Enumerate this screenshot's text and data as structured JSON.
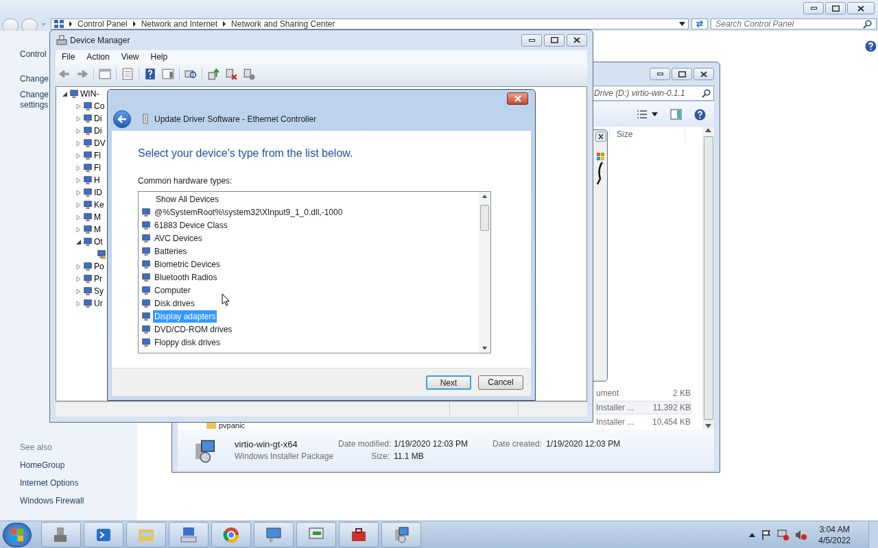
{
  "control_panel": {
    "breadcrumb": [
      "Control Panel",
      "Network and Internet",
      "Network and Sharing Center"
    ],
    "search": {
      "placeholder": "Search Control Panel"
    },
    "sidebar_links": [
      "Control",
      "Change",
      "Change settings"
    ],
    "see_also": {
      "title": "See also",
      "links": [
        "HomeGroup",
        "Internet Options",
        "Windows Firewall"
      ]
    }
  },
  "explorer": {
    "address": "Drive (D:) virtio-win-0.1.1",
    "columns": [
      "Size"
    ],
    "rows": [
      {
        "column_1": "ument",
        "size": "2 KB",
        "selected": false
      },
      {
        "column_1": "Installer ...",
        "size": "11,392 KB",
        "selected": true
      },
      {
        "nav_folder": "pvpanic",
        "column_1": "Installer ...",
        "size": "10,454 KB",
        "selected": false
      }
    ],
    "details": {
      "name": "virtio-win-gt-x64",
      "type": "Windows Installer Package",
      "fields": [
        {
          "label": "Date modified:",
          "value": "1/19/2020 12:03 PM"
        },
        {
          "label": "Size:",
          "value": "11.1 MB"
        },
        {
          "label": "Date created:",
          "value": "1/19/2020 12:03 PM"
        }
      ]
    }
  },
  "device_manager": {
    "title": "Device Manager",
    "menu": [
      "File",
      "Action",
      "View",
      "Help"
    ],
    "tree": {
      "label": "WIN-",
      "expanded": true,
      "children": [
        {
          "label": "Co",
          "expanded": false
        },
        {
          "label": "Di",
          "expanded": false
        },
        {
          "label": "Di",
          "expanded": false
        },
        {
          "label": "DV",
          "expanded": false
        },
        {
          "label": "Fl",
          "expanded": false
        },
        {
          "label": "Fl",
          "expanded": false
        },
        {
          "label": "H",
          "expanded": false
        },
        {
          "label": "ID",
          "expanded": false
        },
        {
          "label": "Ke",
          "expanded": false
        },
        {
          "label": "M",
          "expanded": false
        },
        {
          "label": "M",
          "expanded": false
        },
        {
          "label": "Ot",
          "expanded": true,
          "children": [
            {
              "kind": "warning"
            }
          ]
        },
        {
          "label": "Po",
          "expanded": false
        },
        {
          "label": "Pr",
          "expanded": false
        },
        {
          "label": "Sy",
          "expanded": false
        },
        {
          "label": "Ur",
          "expanded": false
        }
      ]
    }
  },
  "dialog": {
    "title": "Update Driver Software - Ethernet Controller",
    "heading": "Select your device's type from the list below.",
    "list_label": "Common hardware types:",
    "items": [
      {
        "kind": "all",
        "label": "Show All Devices",
        "selected": false
      },
      {
        "kind": "class",
        "label": "@%SystemRoot%\\system32\\XInput9_1_0.dll,-1000",
        "selected": false
      },
      {
        "kind": "class",
        "label": "61883 Device Class",
        "selected": false
      },
      {
        "kind": "class",
        "label": "AVC Devices",
        "selected": false
      },
      {
        "kind": "class",
        "label": "Batteries",
        "selected": false
      },
      {
        "kind": "class",
        "label": "Biometric Devices",
        "selected": false
      },
      {
        "kind": "class",
        "label": "Bluetooth Radios",
        "selected": false
      },
      {
        "kind": "class",
        "label": "Computer",
        "selected": false
      },
      {
        "kind": "class",
        "label": "Disk drives",
        "selected": false
      },
      {
        "kind": "class",
        "label": "Display adapters",
        "selected": true
      },
      {
        "kind": "class",
        "label": "DVD/CD-ROM drives",
        "selected": false
      },
      {
        "kind": "class",
        "label": "Floppy disk drives",
        "selected": false
      }
    ],
    "buttons": [
      {
        "label": "Next",
        "default": true
      },
      {
        "label": "Cancel",
        "default": false
      }
    ]
  },
  "taskbar": {
    "clock": {
      "time": "3:04 AM",
      "date": "4/5/2022"
    }
  }
}
